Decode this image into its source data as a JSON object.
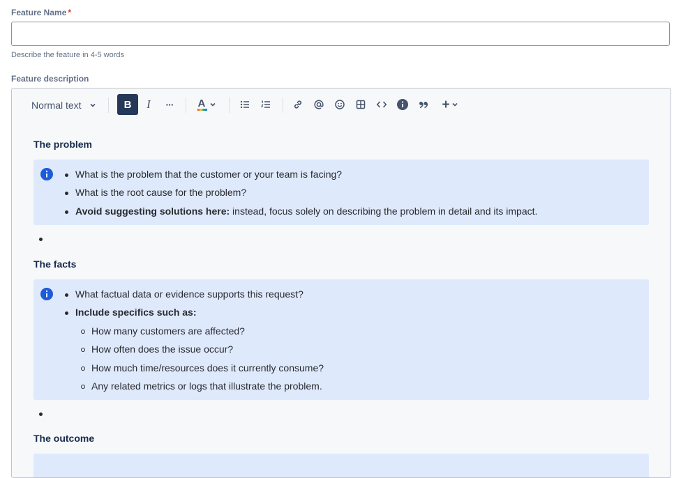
{
  "feature_name": {
    "label": "Feature Name",
    "required_mark": "*",
    "value": "",
    "placeholder": "",
    "helper": "Describe the feature in 4-5 words"
  },
  "description": {
    "label": "Feature description"
  },
  "toolbar": {
    "text_style": "Normal text",
    "bold": "B",
    "italic": "I",
    "more": "···",
    "text_color": "A",
    "insert": "+"
  },
  "sections": [
    {
      "heading": "The problem",
      "items": [
        {
          "text": "What is the problem that the customer or your team is facing?"
        },
        {
          "text": "What is the root cause for the problem?"
        },
        {
          "bold": "Avoid suggesting solutions here:",
          "text": " instead, focus solely on describing the problem in detail and its impact."
        }
      ]
    },
    {
      "heading": "The facts",
      "items": [
        {
          "text": "What factual data or evidence supports this request?"
        },
        {
          "bold": "Include specifics such as:"
        }
      ],
      "subitems": [
        "How many customers are affected?",
        "How often does the issue occur?",
        "How much time/resources does it currently consume?",
        "Any related metrics or logs that illustrate the problem."
      ]
    },
    {
      "heading": "The outcome"
    }
  ],
  "colors": {
    "panel": "#dee9fc",
    "info_icon": "#1d5bd7",
    "bold_active": "#253858",
    "required": "#c9372c"
  }
}
